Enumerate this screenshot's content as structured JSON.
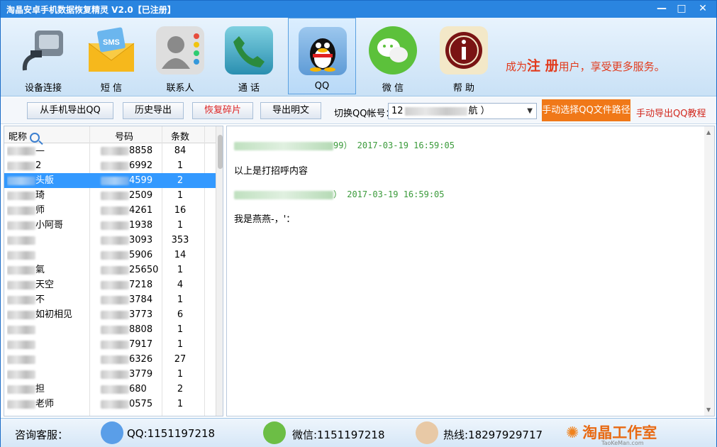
{
  "window": {
    "title": "淘晶安卓手机数据恢复精灵 V2.0【已注册】",
    "controls": {
      "minimize": "—",
      "maximize": "□",
      "close": "✕"
    }
  },
  "toolbar": {
    "items": [
      {
        "label": "设备连接",
        "icon": "usb-device-icon",
        "active": false
      },
      {
        "label": "短 信",
        "icon": "sms-envelope-icon",
        "active": false
      },
      {
        "label": "联系人",
        "icon": "contacts-icon",
        "active": false
      },
      {
        "label": "通 话",
        "icon": "phone-call-icon",
        "active": false
      },
      {
        "label": "QQ",
        "icon": "qq-penguin-icon",
        "active": true
      },
      {
        "label": "微 信",
        "icon": "wechat-icon",
        "active": false
      },
      {
        "label": "帮 助",
        "icon": "help-info-icon",
        "active": false
      }
    ],
    "promo": {
      "pre": "成为",
      "em": "注 册",
      "post": "用户，享受更多服务。"
    }
  },
  "actions": {
    "export_from_phone": "从手机导出QQ",
    "history_export": "历史导出",
    "recover_fragments": "恢复碎片",
    "export_plaintext": "导出明文",
    "switch_label": "切换QQ帐号：",
    "account_prefix": "12",
    "account_suffix": "航 ）",
    "manual_path": "手动选择QQ文件路径",
    "manual_tutorial": "手动导出QQ教程"
  },
  "contacts": {
    "headers": {
      "name": "昵称",
      "number": "号码",
      "count": "条数"
    },
    "rows": [
      {
        "name": "—",
        "number": "8858",
        "count": "84",
        "selected": false
      },
      {
        "name": "2",
        "number": "6992",
        "count": "1",
        "selected": false
      },
      {
        "name": "头舨",
        "number": "4599",
        "count": "2",
        "selected": true
      },
      {
        "name": "琦",
        "number": "2509",
        "count": "1",
        "selected": false
      },
      {
        "name": "师",
        "number": "4261",
        "count": "16",
        "selected": false
      },
      {
        "name": "小阿哥",
        "number": "1938",
        "count": "1",
        "selected": false
      },
      {
        "name": "",
        "number": "3093",
        "count": "353",
        "selected": false
      },
      {
        "name": "",
        "number": "5906",
        "count": "14",
        "selected": false
      },
      {
        "name": "氣",
        "number": "25650",
        "count": "1",
        "selected": false
      },
      {
        "name": "天空",
        "number": "7218",
        "count": "4",
        "selected": false
      },
      {
        "name": "不",
        "number": "3784",
        "count": "1",
        "selected": false
      },
      {
        "name": "如初相见",
        "number": "3773",
        "count": "6",
        "selected": false
      },
      {
        "name": "",
        "number": "8808",
        "count": "1",
        "selected": false
      },
      {
        "name": "",
        "number": "7917",
        "count": "1",
        "selected": false
      },
      {
        "name": "",
        "number": "6326",
        "count": "27",
        "selected": false
      },
      {
        "name": "",
        "number": "3779",
        "count": "1",
        "selected": false
      },
      {
        "name": "担",
        "number": "680",
        "count": "2",
        "selected": false
      },
      {
        "name": "老师",
        "number": "0575",
        "count": "1",
        "selected": false
      }
    ]
  },
  "messages": [
    {
      "header_suffix": "99）  2017-03-19 16:59:05",
      "text": "以上是打招呼内容"
    },
    {
      "header_suffix": "）  2017-03-19 16:59:05",
      "text": "我是燕燕-，'："
    }
  ],
  "footer": {
    "service_label": "咨询客服：",
    "qq": "QQ:1151197218",
    "wechat": "微信:1151197218",
    "hotline": "热线:18297929717",
    "logo_text": "淘晶工作室",
    "logo_sub": "TaoKeMan.com"
  },
  "colors": {
    "title_bar": "#2a85e0",
    "accent_orange": "#f07818",
    "promo_red": "#e23a1c",
    "selection": "#3399ff",
    "timestamp_green": "#3a9a3a"
  }
}
